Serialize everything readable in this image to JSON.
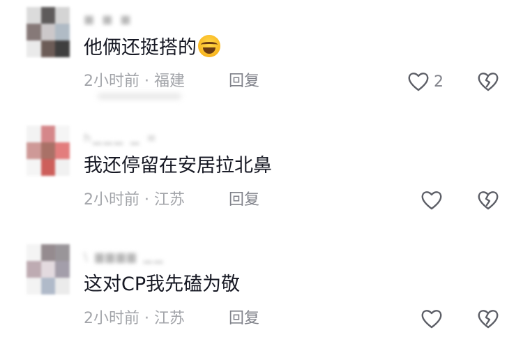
{
  "comments": [
    {
      "username": "■ ■ ■",
      "text": "他俩还挺搭的",
      "has_emoji": true,
      "emoji_name": "laughing-crying-emoji",
      "meta": "2小时前 · 福建",
      "reply": "回复",
      "like_count": "2",
      "avatar_colors": [
        "#d8d8d8",
        "#4d4a4a",
        "#d0d0d0",
        "#7a6b6a",
        "#c7c3c5",
        "#a8b4bf",
        "#e8e8e8",
        "#5d4b45",
        "#2b2b2b"
      ]
    },
    {
      "username": "h▁▁▁ ▁ ≡",
      "text": "我还停留在安居拉北鼻",
      "has_emoji": false,
      "meta": "2小时前 · 江苏",
      "reply": "回复",
      "like_count": "",
      "avatar_colors": [
        "#f2f2f2",
        "#d17b7e",
        "#f4f4f4",
        "#c98f8c",
        "#a06257",
        "#e07070",
        "#f4f4f4",
        "#c84e4a",
        "#f0f0f0"
      ]
    },
    {
      "username": "\\ ▆▆▆▆ ▁▁",
      "text": "这对CP我先磕为敬",
      "has_emoji": false,
      "meta": "2小时前 · 江苏",
      "reply": "回复",
      "like_count": "",
      "avatar_colors": [
        "#f3f3f3",
        "#8a7f83",
        "#8f8a8f",
        "#b8a3aa",
        "#e0d6dc",
        "#9a94a1",
        "#f2f2f2",
        "#a8b3c4",
        "#e9e9e9"
      ]
    }
  ],
  "colors": {
    "text": "#161823",
    "meta": "#a3a5aa",
    "icon": "#5c5e66"
  }
}
